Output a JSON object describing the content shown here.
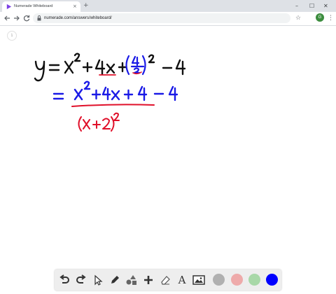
{
  "browser": {
    "tab_title": "Numerade Whiteboard",
    "tab_close": "×",
    "new_tab": "+",
    "url": "numerade.com/answers/whiteboard/",
    "profile_initial": "G",
    "window_controls": [
      "–",
      "☐",
      "✕"
    ]
  },
  "page": {
    "number": "1"
  },
  "whiteboard": {
    "line1": "y = x² + 4x + (4/2)² − 4",
    "line2": "= x² + 4x + 4 − 4",
    "line3": "(x + 2)²",
    "colors": {
      "black": "#111111",
      "blue": "#1a1ae6",
      "red": "#e0102a"
    }
  },
  "toolbar": {
    "tools": [
      "undo-icon",
      "redo-icon",
      "pointer-icon",
      "pen-icon",
      "shapes-icon",
      "add-icon",
      "eraser-icon",
      "text-icon",
      "image-icon"
    ],
    "text_tool_label": "A",
    "colors": [
      "#b0b0b0",
      "#eeaaaa",
      "#a8d8a8",
      "#0000ff"
    ]
  }
}
